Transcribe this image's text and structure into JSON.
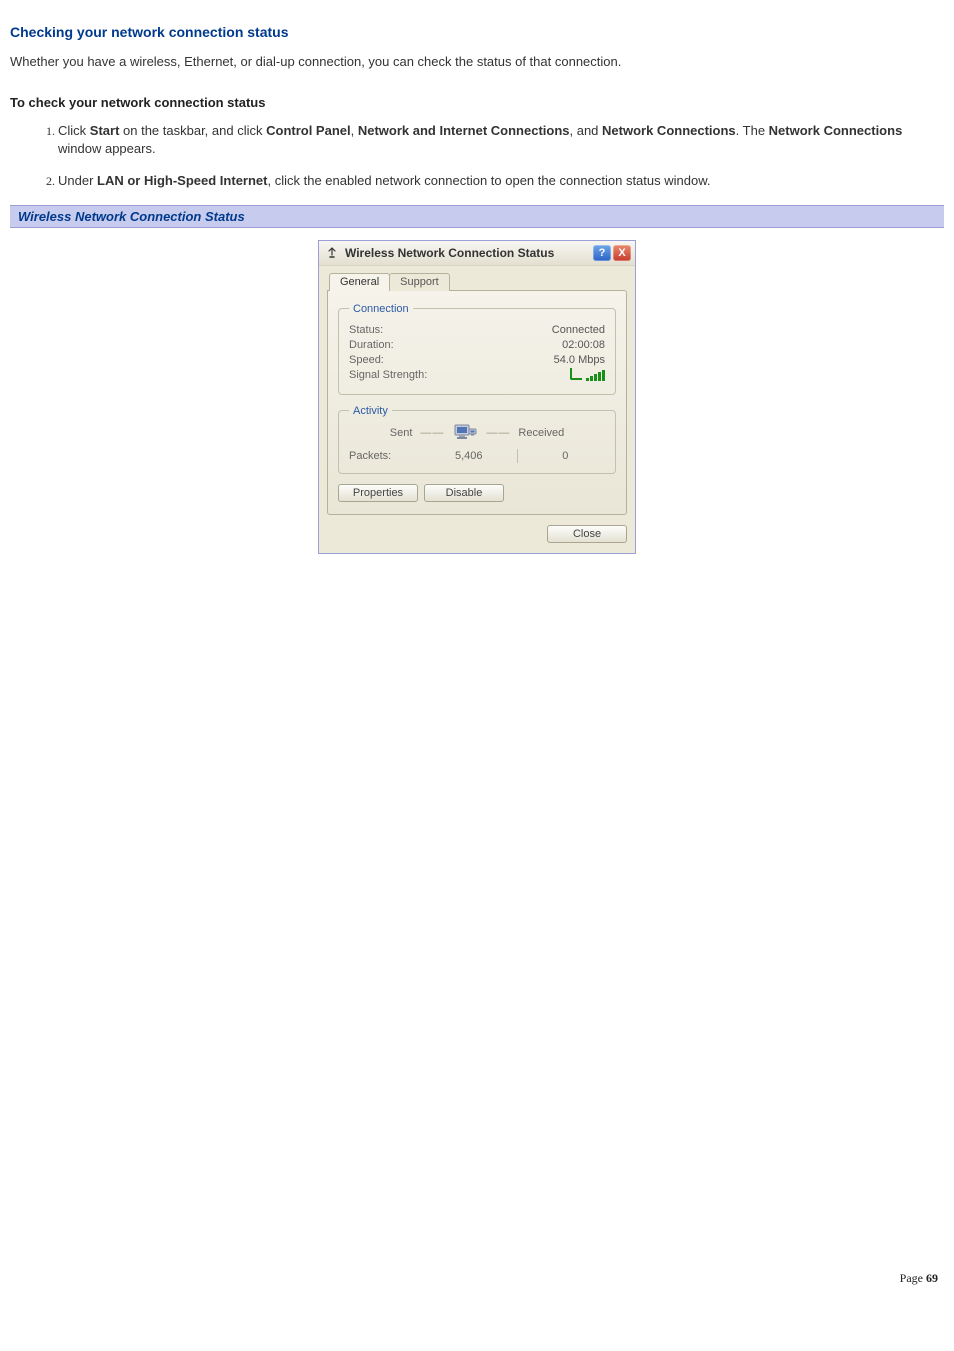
{
  "doc": {
    "h2": "Checking your network connection status",
    "intro": "Whether you have a wireless, Ethernet, or dial-up connection, you can check the status of that connection.",
    "subhead": "To check your network connection status",
    "step1_a": "Click ",
    "step1_b": "Start",
    "step1_c": " on the taskbar, and click ",
    "step1_d": "Control Panel",
    "step1_e": ", ",
    "step1_f": "Network and Internet Connections",
    "step1_g": ", and ",
    "step1_h": "Network Connections",
    "step1_i": ". The ",
    "step1_j": "Network Connections",
    "step1_k": " window appears.",
    "step2_a": "Under ",
    "step2_b": "LAN or High-Speed Internet",
    "step2_c": ", click the enabled network connection to open the connection status window.",
    "caption": "Wireless Network Connection Status",
    "page_label": "Page ",
    "page_num": "69"
  },
  "dialog": {
    "title": "Wireless Network Connection Status",
    "help": "?",
    "close_x": "X",
    "tabs": {
      "general": "General",
      "support": "Support"
    },
    "conn_legend": "Connection",
    "status_lbl": "Status:",
    "status_val": "Connected",
    "duration_lbl": "Duration:",
    "duration_val": "02:00:08",
    "speed_lbl": "Speed:",
    "speed_val": "54.0 Mbps",
    "signal_lbl": "Signal Strength:",
    "act_legend": "Activity",
    "sent": "Sent",
    "received": "Received",
    "packets_lbl": "Packets:",
    "packets_sent": "5,406",
    "packets_recv": "0",
    "btn_properties": "Properties",
    "btn_disable": "Disable",
    "btn_close": "Close"
  }
}
